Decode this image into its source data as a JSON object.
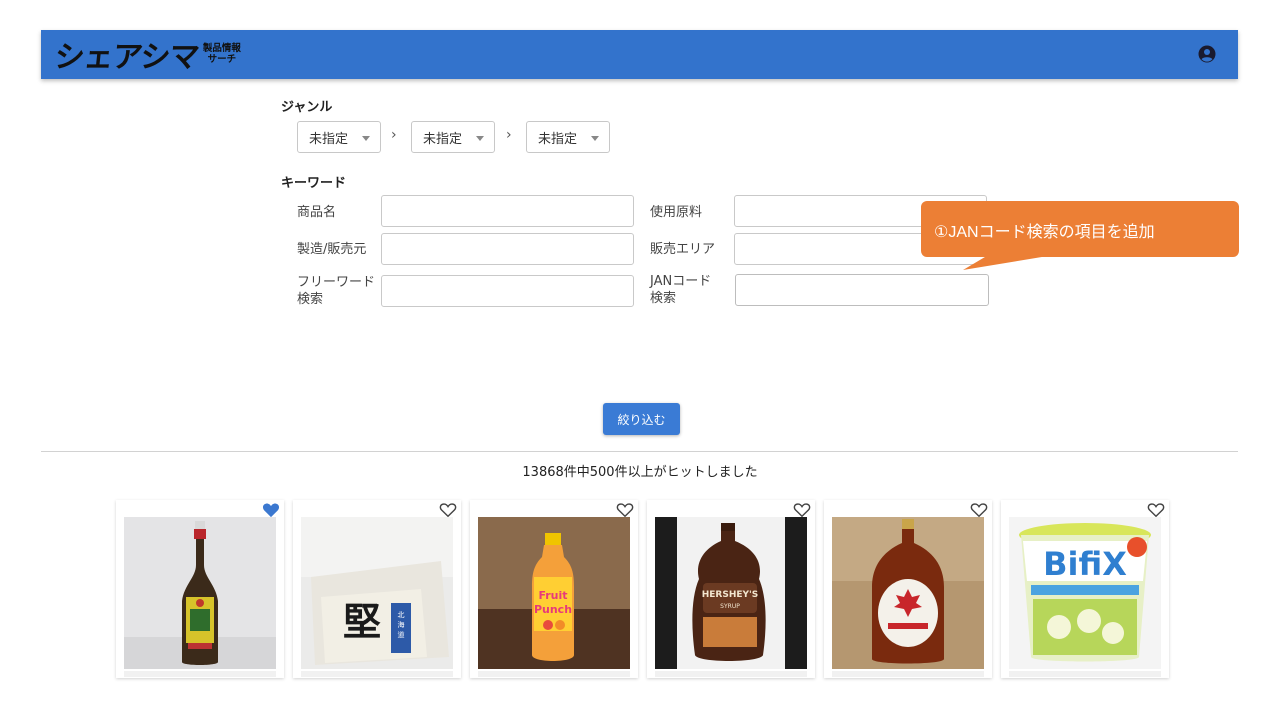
{
  "header": {
    "logo_main": "シェアシマ",
    "logo_sub_line1": "製品情報",
    "logo_sub_line2": "サーチ",
    "account_icon": "account-circle-icon",
    "brand_color": "#3373cc"
  },
  "filters": {
    "genre_label": "ジャンル",
    "genre_selects": [
      "未指定",
      "未指定",
      "未指定"
    ],
    "separator": "›",
    "keyword_label": "キーワード",
    "fields": [
      {
        "label": "商品名",
        "value": "",
        "placeholder": ""
      },
      {
        "label": "使用原料",
        "value": "",
        "placeholder": ""
      },
      {
        "label": "製造/販売元",
        "value": "",
        "placeholder": ""
      },
      {
        "label": "販売エリア",
        "value": "",
        "placeholder": ""
      },
      {
        "label_line1": "フリーワード",
        "label_line2": "検索",
        "value": "",
        "placeholder": ""
      },
      {
        "label_line1": "JANコード",
        "label_line2": "検索",
        "value": "",
        "placeholder": ""
      }
    ]
  },
  "callout": {
    "text": "①JANコード検索の項目を追加",
    "color": "#ec7f35"
  },
  "apply_button": {
    "label": "絞り込む"
  },
  "results": {
    "summary": "13868件中500件以上がヒットしました"
  },
  "products": [
    {
      "favorite": true,
      "image": "soy-sauce-bottle"
    },
    {
      "favorite": false,
      "image": "tofu-block-package"
    },
    {
      "favorite": false,
      "image": "fruit-punch-bottle"
    },
    {
      "favorite": false,
      "image": "chocolate-syrup-bottle"
    },
    {
      "favorite": false,
      "image": "maple-syrup-bottle"
    },
    {
      "favorite": false,
      "image": "yogurt-cup"
    }
  ],
  "colors": {
    "accent": "#3a7bd5",
    "favorite_heart": "#3b78d0"
  }
}
